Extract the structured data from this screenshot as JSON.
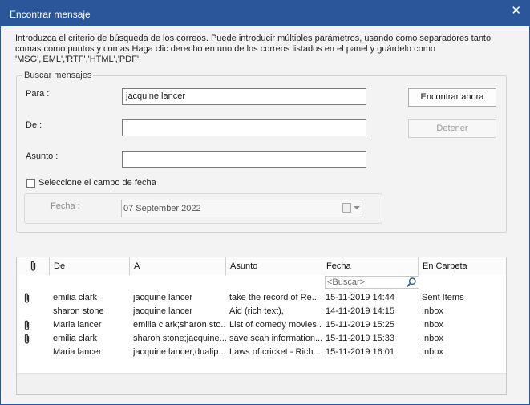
{
  "window": {
    "title": "Encontrar mensaje",
    "close_glyph": "✕"
  },
  "intro_text": "Introduzca el criterio de búsqueda de los correos. Puede introducir múltiples parámetros, usando como separadores tanto comas como puntos y comas.Haga clic derecho en uno de los correos listados en el panel y guárdelo como 'MSG','EML','RTF','HTML','PDF'.",
  "search_group": {
    "legend": "Buscar mensajes",
    "para_label": "Para :",
    "para_value": "jacquine lancer",
    "de_label": "De :",
    "de_value": "",
    "asunto_label": "Asunto :",
    "asunto_value": "",
    "find_button": "Encontrar ahora",
    "stop_button": "Detener",
    "date_checkbox_label": "Seleccione el campo de fecha",
    "date_checkbox_checked": false,
    "fecha_label": "Fecha :",
    "fecha_value": "07 September 2022"
  },
  "results": {
    "columns": [
      "De",
      "A",
      "Asunto",
      "Fecha",
      "En Carpeta"
    ],
    "search_placeholder": "<Buscar>",
    "rows": [
      {
        "attachment": true,
        "de": "emilia clark",
        "a": "jacquine lancer",
        "asunto": "take the record of Re...",
        "fecha": "15-11-2019 14:44",
        "carpeta": "Sent Items"
      },
      {
        "attachment": false,
        "de": "sharon stone",
        "a": "jacquine lancer",
        "asunto": "Aid (rich text),",
        "fecha": "14-11-2019 14:15",
        "carpeta": "Inbox"
      },
      {
        "attachment": true,
        "de": "Maria lancer",
        "a": "emilia clark;sharon sto...",
        "asunto": "List of comedy movies...",
        "fecha": "15-11-2019 15:25",
        "carpeta": "Inbox"
      },
      {
        "attachment": true,
        "de": "emilia clark",
        "a": "sharon stone;jacquine...",
        "asunto": "save scan information...",
        "fecha": "15-11-2019 15:33",
        "carpeta": "Inbox"
      },
      {
        "attachment": false,
        "de": "Maria lancer",
        "a": "jacquine lancer;dualip...",
        "asunto": "Laws of cricket - Rich...",
        "fecha": "15-11-2019 16:01",
        "carpeta": "Inbox"
      }
    ]
  },
  "colors": {
    "titlebar": "#2b579a",
    "dialog_bg": "#f3f3f3"
  }
}
